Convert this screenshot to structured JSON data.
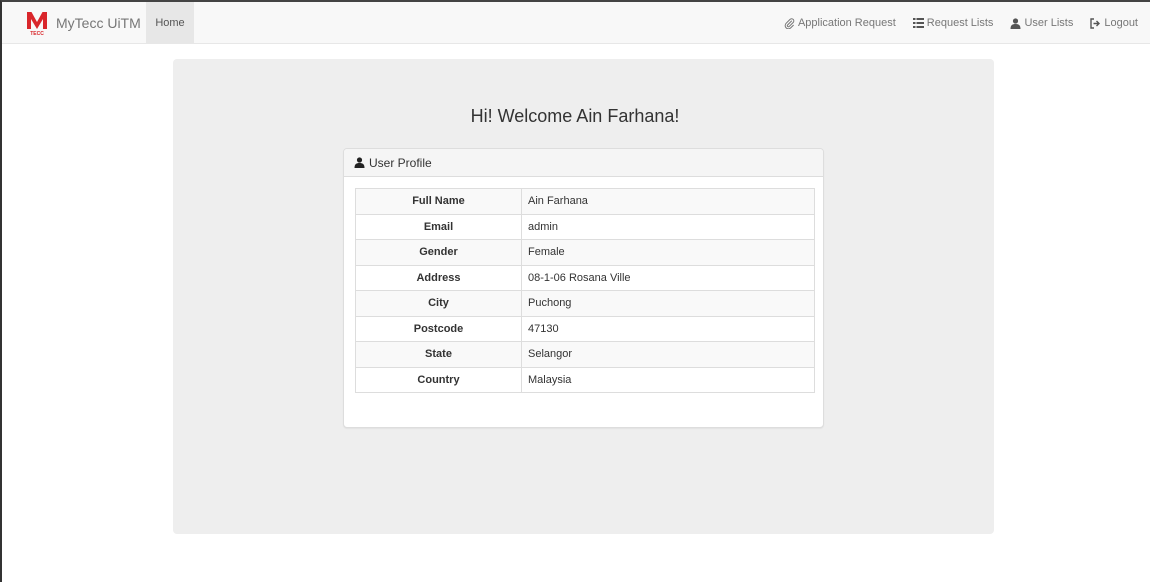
{
  "app": {
    "brand": "MyTecc UiTM",
    "logo_text": "TECC",
    "brand_color": "#d9262b"
  },
  "nav": {
    "home": "Home",
    "links": [
      {
        "label": "Application Request",
        "icon": "paperclip-icon"
      },
      {
        "label": "Request Lists",
        "icon": "list-icon"
      },
      {
        "label": "User Lists",
        "icon": "user-icon"
      },
      {
        "label": "Logout",
        "icon": "logout-icon"
      }
    ]
  },
  "main": {
    "welcome": "Hi! Welcome Ain Farhana!",
    "panel_title": "User Profile",
    "profile": [
      {
        "key": "Full Name",
        "value": "Ain Farhana"
      },
      {
        "key": "Email",
        "value": "admin"
      },
      {
        "key": "Gender",
        "value": "Female"
      },
      {
        "key": "Address",
        "value": "08-1-06 Rosana Ville"
      },
      {
        "key": "City",
        "value": "Puchong"
      },
      {
        "key": "Postcode",
        "value": "47130"
      },
      {
        "key": "State",
        "value": "Selangor"
      },
      {
        "key": "Country",
        "value": "Malaysia"
      }
    ]
  }
}
